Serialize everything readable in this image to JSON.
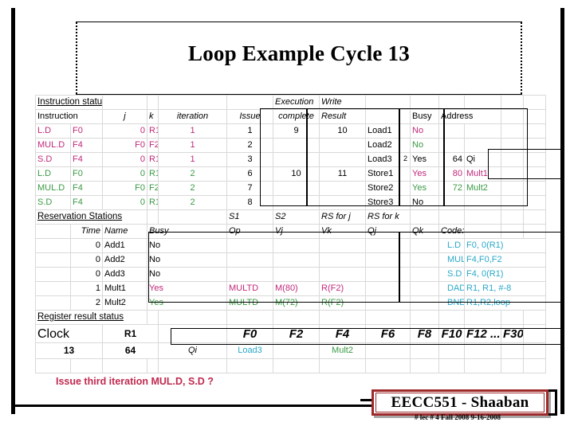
{
  "title": "Loop Example Cycle 13",
  "sections": {
    "instruction_status": "Instruction status",
    "reservation_stations": "Reservation Stations",
    "register_result_status": "Register result status",
    "code_label": "Code:"
  },
  "instruction_status": {
    "headers_row1": {
      "execution": "Execution",
      "write": "Write"
    },
    "headers_row2": {
      "instruction": "Instruction",
      "j": "j",
      "k": "k",
      "iteration": "iteration",
      "issue": "Issue",
      "complete": "complete",
      "result": "Result"
    },
    "rows": [
      {
        "op": "L.D",
        "dest": "F0",
        "j": "0",
        "k": "R1",
        "iteration": "1",
        "issue": "1",
        "exec_complete": "9",
        "write_result": "10",
        "color": "pink"
      },
      {
        "op": "MUL.D",
        "dest": "F4",
        "j": "F0",
        "k": "F2",
        "iteration": "1",
        "issue": "2",
        "exec_complete": "",
        "write_result": "",
        "color": "pink"
      },
      {
        "op": "S.D",
        "dest": "F4",
        "j": "0",
        "k": "R1",
        "iteration": "1",
        "issue": "3",
        "exec_complete": "",
        "write_result": "",
        "color": "pink"
      },
      {
        "op": "L.D",
        "dest": "F0",
        "j": "0",
        "k": "R1",
        "iteration": "2",
        "issue": "6",
        "exec_complete": "10",
        "write_result": "11",
        "color": "green"
      },
      {
        "op": "MUL.D",
        "dest": "F4",
        "j": "F0",
        "k": "F2",
        "iteration": "2",
        "issue": "7",
        "exec_complete": "",
        "write_result": "",
        "color": "green"
      },
      {
        "op": "S.D",
        "dest": "F4",
        "j": "0",
        "k": "R1",
        "iteration": "2",
        "issue": "8",
        "exec_complete": "",
        "write_result": "",
        "color": "green"
      }
    ]
  },
  "load_store_buffers": {
    "headers": {
      "busy": "Busy",
      "address": "Address",
      "qi": "Qi"
    },
    "rows": [
      {
        "name": "Load1",
        "time": "",
        "busy": "No",
        "address": "",
        "qi": "",
        "color": "pink"
      },
      {
        "name": "Load2",
        "time": "",
        "busy": "No",
        "address": "",
        "qi": "",
        "color": "green"
      },
      {
        "name": "Load3",
        "time": "2",
        "busy": "Yes",
        "address": "64",
        "qi": "Qi",
        "color": "black"
      },
      {
        "name": "Store1",
        "time": "",
        "busy": "Yes",
        "address": "80",
        "qi": "Mult1",
        "color": "pink"
      },
      {
        "name": "Store2",
        "time": "",
        "busy": "Yes",
        "address": "72",
        "qi": "Mult2",
        "color": "green"
      },
      {
        "name": "Store3",
        "time": "",
        "busy": "No",
        "address": "",
        "qi": "",
        "color": "black"
      }
    ]
  },
  "reservation_stations": {
    "headers_row1": {
      "s1": "S1",
      "s2": "S2",
      "rs_for_j": "RS for j",
      "rs_for_k": "RS for k"
    },
    "headers_row2": {
      "time": "Time",
      "name": "Name",
      "busy": "Busy",
      "op": "Op",
      "vj": "Vj",
      "vk": "Vk",
      "qj": "Qj",
      "qk": "Qk"
    },
    "rows": [
      {
        "time": "0",
        "name": "Add1",
        "busy": "No",
        "op": "",
        "vj": "",
        "vk": "",
        "qj": "",
        "qk": "",
        "color": "black"
      },
      {
        "time": "0",
        "name": "Add2",
        "busy": "No",
        "op": "",
        "vj": "",
        "vk": "",
        "qj": "",
        "qk": "",
        "color": "black"
      },
      {
        "time": "0",
        "name": "Add3",
        "busy": "No",
        "op": "",
        "vj": "",
        "vk": "",
        "qj": "",
        "qk": "",
        "color": "black"
      },
      {
        "time": "1",
        "name": "Mult1",
        "busy": "Yes",
        "op": "MULTD",
        "vj": "M(80)",
        "vk": "R(F2)",
        "qj": "",
        "qk": "",
        "color": "pink"
      },
      {
        "time": "2",
        "name": "Mult2",
        "busy": "Yes",
        "op": "MULTD",
        "vj": "M(72)",
        "vk": "R(F2)",
        "qj": "",
        "qk": "",
        "color": "green"
      }
    ]
  },
  "code": {
    "label": "Code:",
    "lines": [
      {
        "op": "L.D",
        "operands": "F0, 0(R1)"
      },
      {
        "op": "MUL.D",
        "operands": "F4,F0,F2"
      },
      {
        "op": "S.D",
        "operands": "F4, 0(R1)"
      },
      {
        "op": "DADDUI",
        "operands": "R1, R1, #-8"
      },
      {
        "op": "BNE",
        "operands": "R1,R2,loop"
      }
    ]
  },
  "register_result_status": {
    "clock_label": "Clock",
    "clock_value": "13",
    "r1_label": "R1",
    "r1_value": "64",
    "qi_label": "Qi",
    "registers": [
      "F0",
      "F2",
      "F4",
      "F6",
      "F8",
      "F10",
      "F12 ...",
      "F30"
    ],
    "values": [
      "Load3",
      "",
      "Mult2",
      "",
      "",
      "",
      "",
      ""
    ],
    "value_colors": [
      "cyan",
      "black",
      "green",
      "black",
      "black",
      "black",
      "black",
      "black"
    ]
  },
  "question": "Issue third iteration MUL.D,  S.D ?",
  "footer": {
    "course": "EECC551 - Shaaban",
    "subtext": "#  lec # 4  Fall 2008   9-16-2008"
  },
  "colors": {
    "pink": "#c0297a",
    "green": "#3a9a44",
    "cyan": "#2aa8c9",
    "black": "#000000",
    "question": "#c0294f",
    "footer_border": "#9e2a2b",
    "grid_line": "#d9d9d9"
  }
}
